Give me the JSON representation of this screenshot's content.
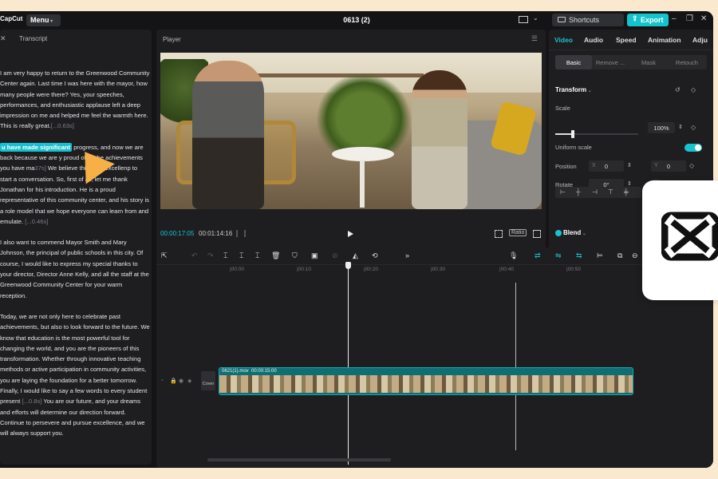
{
  "titlebar": {
    "logo": "CapCut",
    "menu_label": "Menu",
    "project_title": "0613 (2)",
    "shortcuts_label": "Shortcuts",
    "export_label": "Export"
  },
  "transcript": {
    "title": "Transcript",
    "paragraphs": [
      {
        "pre": "I am very happy to return to the Greenwood Community Center again. Last time I was here with the mayor, how many people were there? Yes, your speeches, performances, and enthusiastic applause left a deep impression on me and helped me feel the warmth here. This is really great.",
        "ts": "[...0.63s]"
      },
      {
        "highlight": "u have made significant",
        "mid": " progress, and now we are back because we are ",
        "mid2": "y proud of all the achievements you have ma",
        "ts2": "37s]",
        "post": " We believe this is an excellen",
        "post2": "p to start a conversation. So, first of all, let me thank Jonathan for his introduction. He is a proud representative of this community center, and his story is a role model that we hope everyone can learn from and emulate.",
        "ts3": "[...0.46s]"
      },
      {
        "pre": "I also want to commend Mayor Smith and Mary Johnson, the principal of public schools in this city. Of course, I would like to express my special thanks to your director, Director Anne Kelly, and all the staff at the Greenwood Community Center for your warm reception."
      },
      {
        "pre": "Today, we are not only here to celebrate past achievements, but also to look forward to the future. We know that education is the most powerful tool for changing the world, and you are the pioneers of this transformation. Whether through innovative teaching methods or active participation in community activities, you are laying the foundation for a better tomorrow.",
        "line2": "Finally, I would like to say a few words to every student present ",
        "ts": "[...0.8s]",
        "post": " You are our future, and your dreams and efforts will determine our direction forward. Continue to persevere and pursue excellence, and we will always support you."
      }
    ]
  },
  "player": {
    "title": "Player",
    "time_current": "00:00:17:05",
    "time_total": "00:01:14:16",
    "ratio_label": "Ratio"
  },
  "inspector": {
    "tabs": [
      "Video",
      "Audio",
      "Speed",
      "Animation",
      "Adju"
    ],
    "subtabs": [
      "Basic",
      "Remove ...",
      "Mask",
      "Retouch"
    ],
    "transform_title": "Transform",
    "scale_label": "Scale",
    "scale_value": "100%",
    "uniform_scale_label": "Uniform scale",
    "position_label": "Position",
    "pos_x_axis": "X",
    "pos_x": "0",
    "pos_y_axis": "Y",
    "pos_y": "0",
    "rotate_label": "Rotate",
    "rotate_value": "0°",
    "rotate_dash": "-",
    "blend_label": "Blend",
    "scale_fraction": 0.21
  },
  "timeline": {
    "ruler": [
      "|00:00",
      "|00:10",
      "|00:20",
      "|00:30",
      "|00:40",
      "|00:50"
    ],
    "clip_name": "0621(1).mov",
    "clip_duration": "00:00:15:00",
    "cover_label": "Cover"
  },
  "colors": {
    "accent": "#19c2cf",
    "background": "#fbe9cf"
  }
}
